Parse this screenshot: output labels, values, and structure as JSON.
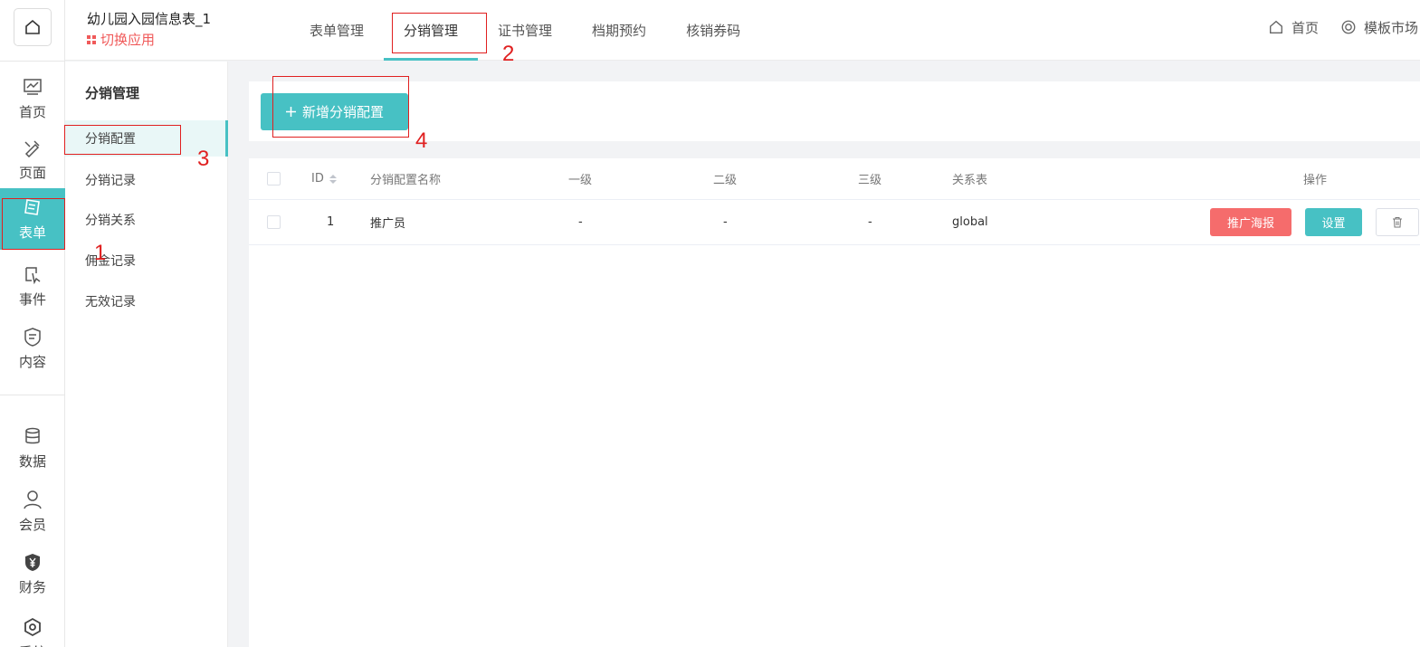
{
  "header": {
    "app_title": "幼儿园入园信息表_1",
    "switch_app": "切换应用",
    "tabs": [
      {
        "label": "表单管理"
      },
      {
        "label": "分销管理"
      },
      {
        "label": "证书管理"
      },
      {
        "label": "档期预约"
      },
      {
        "label": "核销券码"
      }
    ],
    "home_link": "首页",
    "template_link": "模板市场"
  },
  "rail": {
    "items": [
      {
        "label": "首页",
        "icon": "dashboard-icon"
      },
      {
        "label": "页面",
        "icon": "brush-icon"
      },
      {
        "label": "表单",
        "icon": "form-icon"
      },
      {
        "label": "事件",
        "icon": "event-icon"
      },
      {
        "label": "内容",
        "icon": "content-icon"
      },
      {
        "label": "数据",
        "icon": "database-icon"
      },
      {
        "label": "会员",
        "icon": "user-icon"
      },
      {
        "label": "财务",
        "icon": "yen-shield-icon"
      },
      {
        "label": "系统",
        "icon": "settings-hex-icon"
      }
    ]
  },
  "subnav": {
    "title": "分销管理",
    "items": [
      {
        "label": "分销配置"
      },
      {
        "label": "分销记录"
      },
      {
        "label": "分销关系"
      },
      {
        "label": "佣金记录"
      },
      {
        "label": "无效记录"
      }
    ]
  },
  "toolbar": {
    "add_label": "新增分销配置"
  },
  "table": {
    "columns": {
      "id": "ID",
      "name": "分销配置名称",
      "level1": "一级",
      "level2": "二级",
      "level3": "三级",
      "relation": "关系表",
      "actions": "操作"
    },
    "rows": [
      {
        "id": "1",
        "name": "推广员",
        "level1": "-",
        "level2": "-",
        "level3": "-",
        "relation": "global",
        "poster_btn": "推广海报",
        "settings_btn": "设置"
      }
    ]
  },
  "annotations": {
    "n1": "1",
    "n2": "2",
    "n3": "3",
    "n4": "4"
  },
  "colors": {
    "accent": "#47c1c4",
    "danger": "#f56c6c",
    "annotation": "#e02020"
  }
}
